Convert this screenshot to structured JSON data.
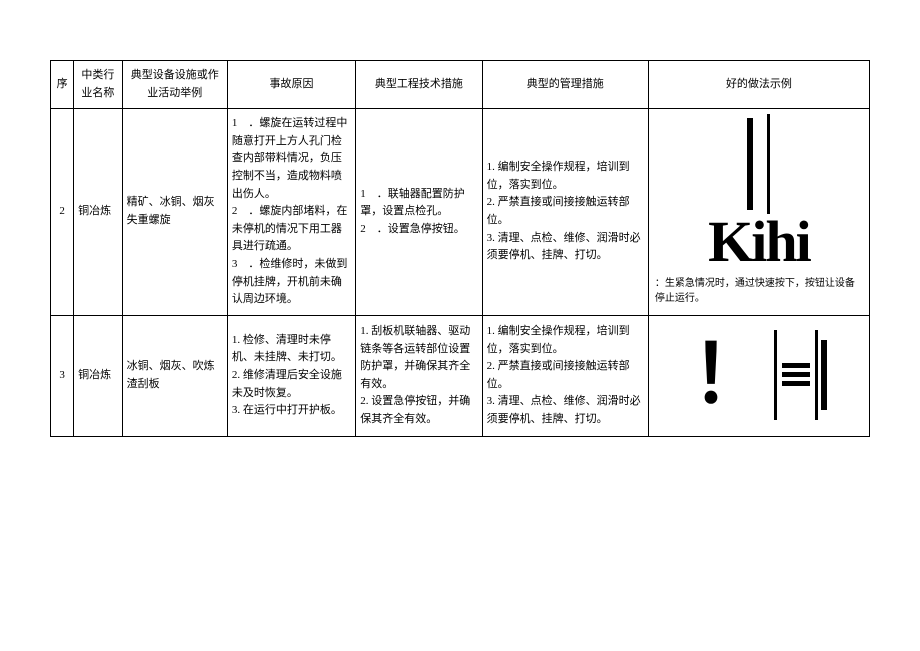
{
  "headers": {
    "seq": "序",
    "industry": "中类行业名称",
    "equipment": "典型设备设施或作业活动举例",
    "cause": "事故原因",
    "tech": "典型工程技术措施",
    "mgmt": "典型的管理措施",
    "demo": "好的做法示例"
  },
  "rows": [
    {
      "seq": "2",
      "industry": "铜冶炼",
      "equipment": "精矿、冰铜、烟灰失重螺旋",
      "cause": "1　．螺旋在运转过程中随意打开上方人孔门检查内部带料情况，负压控制不当，造成物料喷出伤人。\n2　．螺旋内部堵料，在未停机的情况下用工器具进行疏通。\n3　．检维修时，未做到停机挂牌，开机前未确认周边环境。",
      "tech": "1　．联轴器配置防护罩，设置点检孔。\n2　．设置急停按钮。",
      "mgmt": "1. 编制安全操作规程，培训到位，落实到位。\n2. 严禁直接或间接接触运转部位。\n3. 清理、点检、维修、润滑时必须要停机、挂牌、打切。",
      "demoGlyph": "Kihi",
      "demoCaption": "：生紧急情况时，通过快速按下，按钮让设备停止运行。"
    },
    {
      "seq": "3",
      "industry": "铜冶炼",
      "equipment": "冰铜、烟灰、吹炼渣刮板",
      "cause": "1. 检修、清理时未停机、未挂牌、未打切。\n2. 维修清理后安全设施未及时恢复。\n3. 在运行中打开护板。",
      "tech": "1. 刮板机联轴器、驱动链条等各运转部位设置防护罩，并确保其齐全有效。\n2. 设置急停按钮，并确保其齐全有效。",
      "mgmt": "1. 编制安全操作规程，培训到位，落实到位。\n2. 严禁直接或间接接触运转部位。\n3. 清理、点检、维修、润滑时必须要停机、挂牌、打切。",
      "demoGlyph": "||三||",
      "demoCaption": ""
    }
  ]
}
